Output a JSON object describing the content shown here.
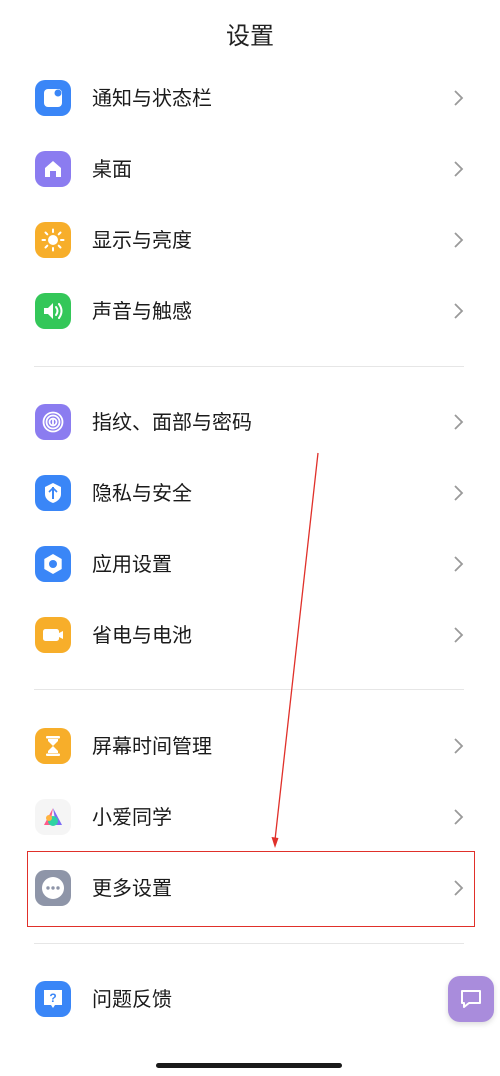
{
  "header": {
    "title": "设置"
  },
  "groups": [
    {
      "items": [
        {
          "label": "通知与状态栏",
          "icon": "notification-icon",
          "color": "#3a86f7"
        },
        {
          "label": "桌面",
          "icon": "home-icon",
          "color": "#8b7cf0"
        },
        {
          "label": "显示与亮度",
          "icon": "sun-icon",
          "color": "#f7ae2a"
        },
        {
          "label": "声音与触感",
          "icon": "speaker-icon",
          "color": "#34c759"
        }
      ]
    },
    {
      "items": [
        {
          "label": "指纹、面部与密码",
          "icon": "fingerprint-icon",
          "color": "#8b7cf0"
        },
        {
          "label": "隐私与安全",
          "icon": "shield-icon",
          "color": "#3a86f7"
        },
        {
          "label": "应用设置",
          "icon": "hexagon-gear-icon",
          "color": "#3a86f7"
        },
        {
          "label": "省电与电池",
          "icon": "battery-icon",
          "color": "#f7ae2a"
        }
      ]
    },
    {
      "items": [
        {
          "label": "屏幕时间管理",
          "icon": "hourglass-icon",
          "color": "#f7ae2a"
        },
        {
          "label": "小爱同学",
          "icon": "xiaoai-logo-icon",
          "color": "#ffffff"
        },
        {
          "label": "更多设置",
          "icon": "more-dots-icon",
          "color": "#8e95a8",
          "highlighted": true
        }
      ]
    },
    {
      "items": [
        {
          "label": "问题反馈",
          "icon": "question-icon",
          "color": "#3a86f7"
        }
      ]
    }
  ],
  "floating_button": {
    "icon": "feedback-chat-icon",
    "color": "#a98cdc"
  },
  "annotation": {
    "color": "#e0302a"
  }
}
